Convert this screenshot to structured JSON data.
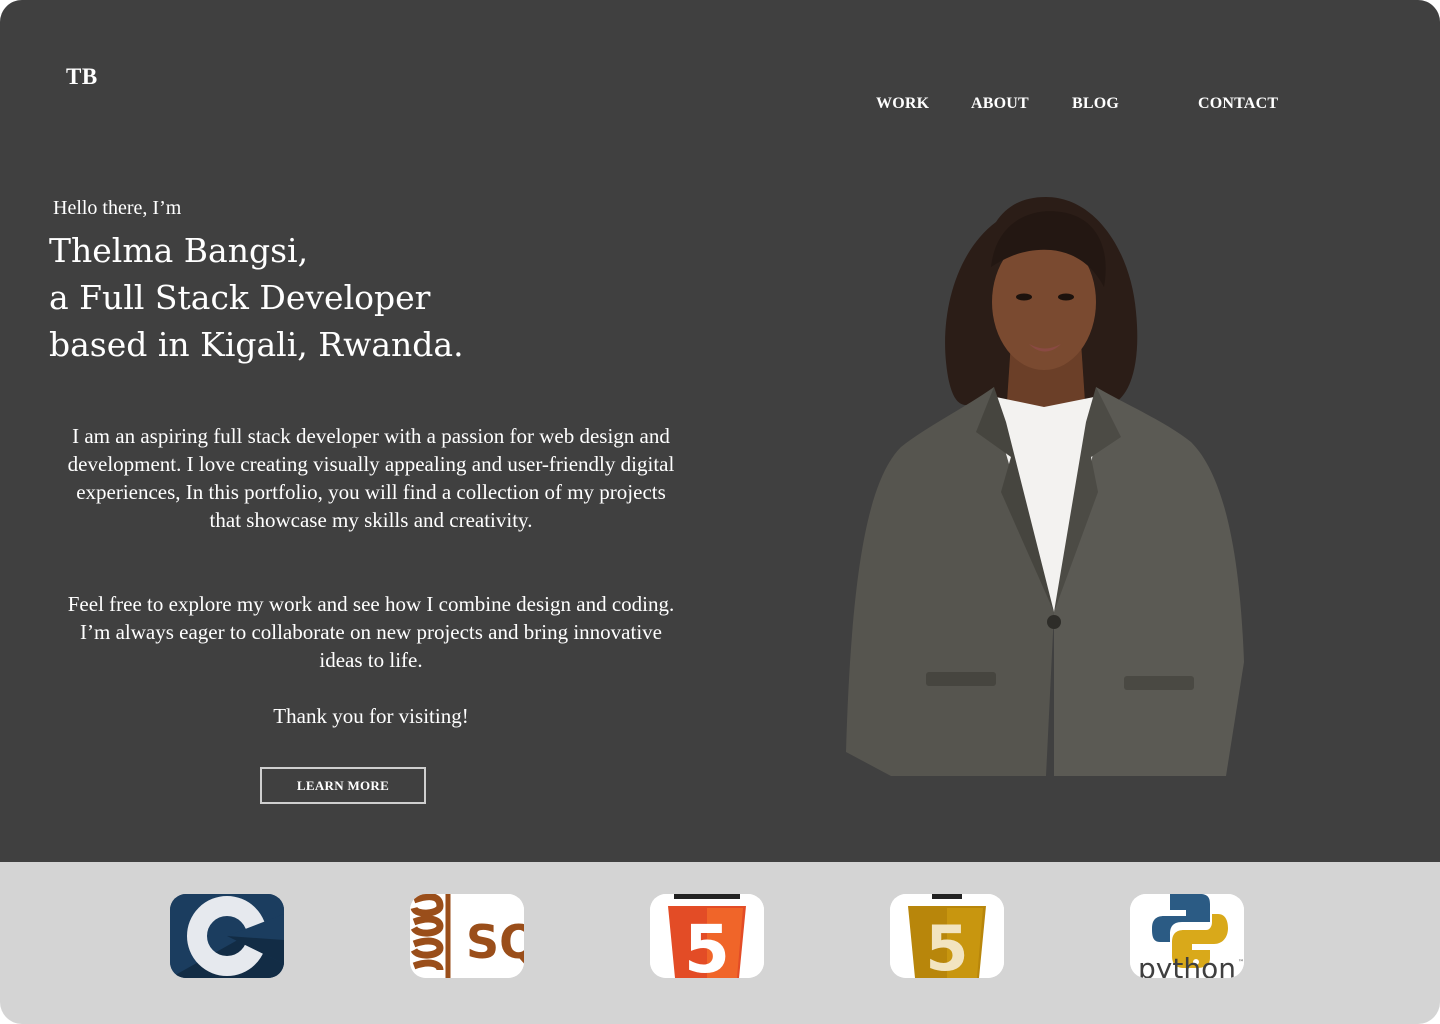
{
  "brand": {
    "logo": "TB"
  },
  "nav": {
    "items": [
      {
        "label": "WORK"
      },
      {
        "label": "ABOUT"
      },
      {
        "label": "BLOG"
      },
      {
        "label": "CONTACT"
      }
    ]
  },
  "hero": {
    "greeting": "Hello there, I’m",
    "headline": [
      "Thelma Bangsi,",
      "a Full Stack Developer",
      "based in Kigali, Rwanda."
    ],
    "paragraphs": [
      "I am an aspiring full stack developer with a passion for web design and development. I love creating visually appealing and user-friendly digital experiences, In this portfolio, you will find a collection of my projects that showcase my skills and creativity.",
      "Feel free to explore my work and see how I combine design and coding. I’m always eager to collaborate on new projects and bring innovative ideas to life.",
      "Thank you for visiting!"
    ],
    "cta_label": "LEARN MORE"
  },
  "tech_logos": [
    {
      "name": "c-logo",
      "icon": "c-language-icon",
      "text": ""
    },
    {
      "name": "sql-logo",
      "icon": "sql-database-icon",
      "text": "SQ"
    },
    {
      "name": "html5-logo",
      "icon": "html5-shield-icon",
      "text": "5"
    },
    {
      "name": "css3-logo",
      "icon": "css3-shield-icon",
      "text": "5"
    },
    {
      "name": "python-logo",
      "icon": "python-snakes-icon",
      "text": "python"
    }
  ],
  "colors": {
    "hero_bg": "#404040",
    "footer_bg": "#d4d4d4",
    "text": "#ffffff",
    "c_blue": "#1b3d5f",
    "sql_brown": "#9a4e1a",
    "html_orange": "#e34c26",
    "css_gold": "#b8860b",
    "python_blue": "#2b5b84",
    "python_yellow": "#d9a91a"
  }
}
